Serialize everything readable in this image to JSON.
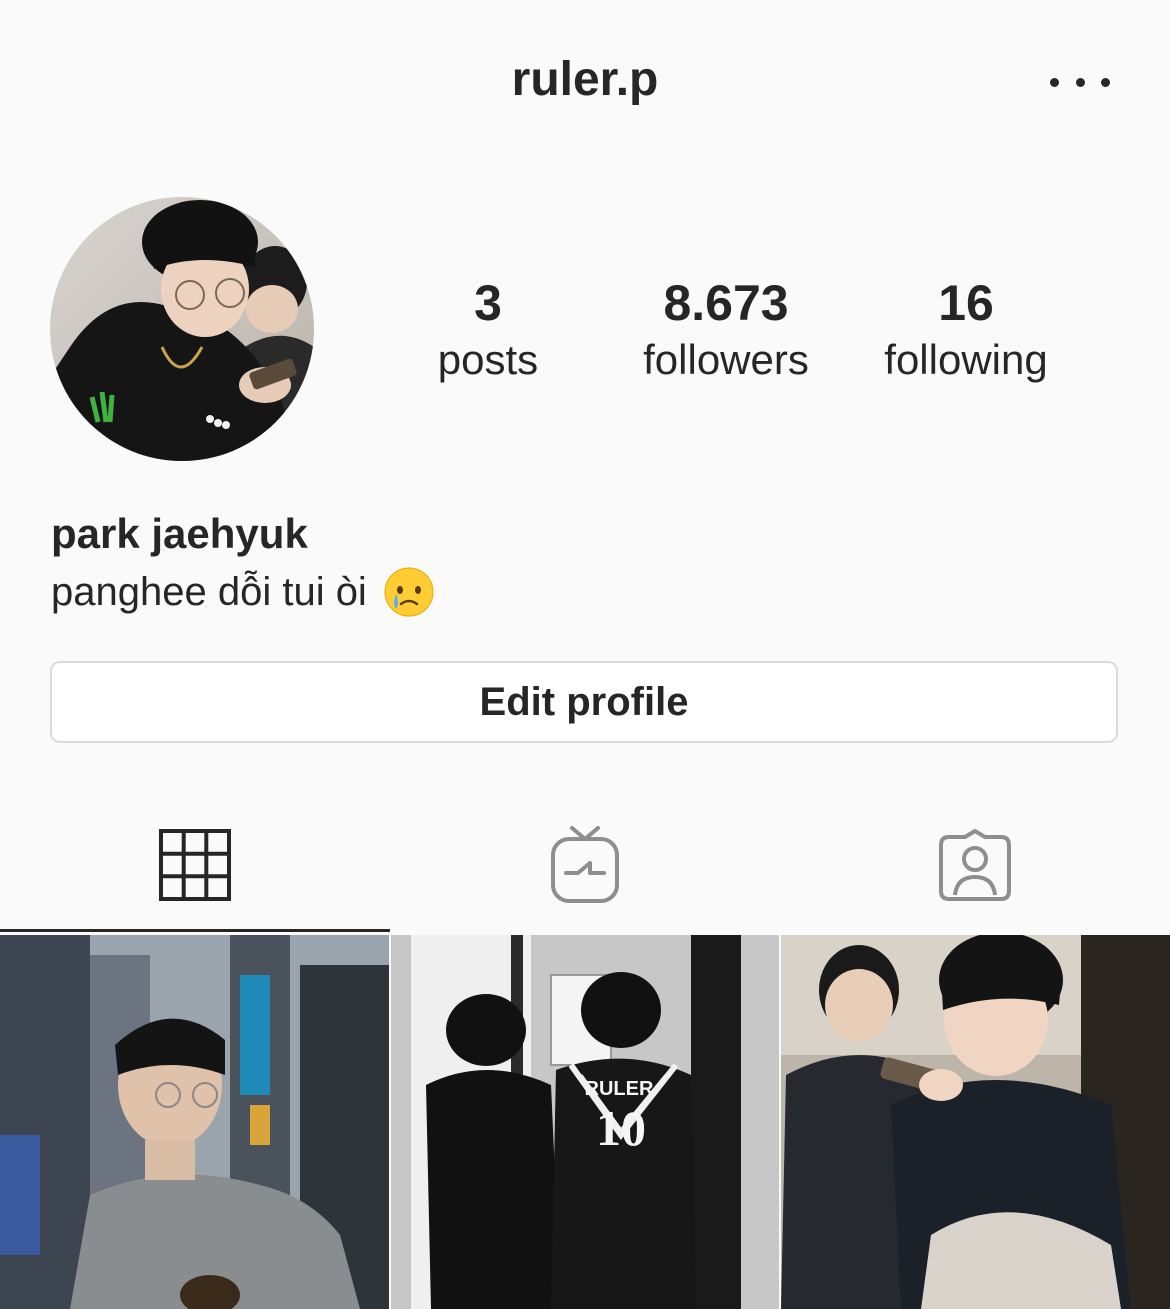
{
  "header": {
    "username": "ruler.p",
    "more_icon": "more-horizontal-icon"
  },
  "profile": {
    "avatar_icon": "profile-photo",
    "stats": [
      {
        "value": "3",
        "label": "posts"
      },
      {
        "value": "8.673",
        "label": "followers"
      },
      {
        "value": "16",
        "label": "following"
      }
    ],
    "name": "park jaehyuk",
    "bio": "panghee dỗi tui òi",
    "bio_emoji": "face-holding-back-tears-emoji"
  },
  "edit_button": {
    "label": "Edit profile"
  },
  "tabs": [
    {
      "icon": "grid-icon",
      "active": true
    },
    {
      "icon": "igtv-icon",
      "active": false
    },
    {
      "icon": "tagged-user-icon",
      "active": false
    }
  ],
  "posts": [
    {
      "icon": "photo-post"
    },
    {
      "icon": "photo-post"
    },
    {
      "icon": "photo-post"
    }
  ],
  "colors": {
    "background": "#fafafa",
    "text": "#262626",
    "border": "#dbdbdb",
    "inactive_icon": "#8e8e8e"
  }
}
